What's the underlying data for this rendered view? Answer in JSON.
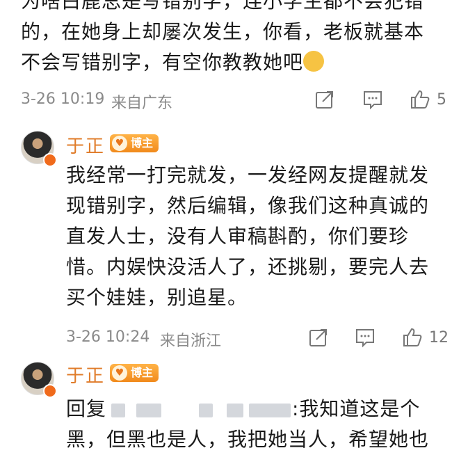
{
  "comments": [
    {
      "text_lines": [
        "为啥白鹿总是写错别字，连小学生都不会犯错",
        "的，在她身上却屡次发生，你看，老板就基本",
        "不会写错别字，有空你教教她吧"
      ],
      "emoji": "笑哭表情",
      "timestamp": "3-26 10:19",
      "location": "来自广东",
      "likes": "5"
    },
    {
      "username": "于正",
      "badge": "博主",
      "text_lines": [
        "我经常一打完就发，一发经网友提醒就发",
        "现错别字，然后编辑，像我们这种真诚的",
        "直发人士，没有人审稿斟酌，你们要珍",
        "惜。内娱快没活人了，还挑剔，要完人去",
        "买个娃娃，别追星。"
      ],
      "timestamp": "3-26 10:24",
      "location": "来自浙江",
      "likes": "12"
    },
    {
      "username": "于正",
      "badge": "博主",
      "reply_prefix": "回复",
      "reply_suffix": ":我知道这是个",
      "text_line2": "黑，但黑也是人，我把她当人，希望她也"
    }
  ],
  "icons": {
    "share": "share-icon",
    "comment": "comment-icon",
    "like": "thumbs-up-icon",
    "verified": "verified-badge-icon",
    "blogger": "blogger-badge-icon"
  },
  "colors": {
    "username": "#e07c2a",
    "badge": "#f18a1c",
    "meta": "#8a8a8a"
  }
}
